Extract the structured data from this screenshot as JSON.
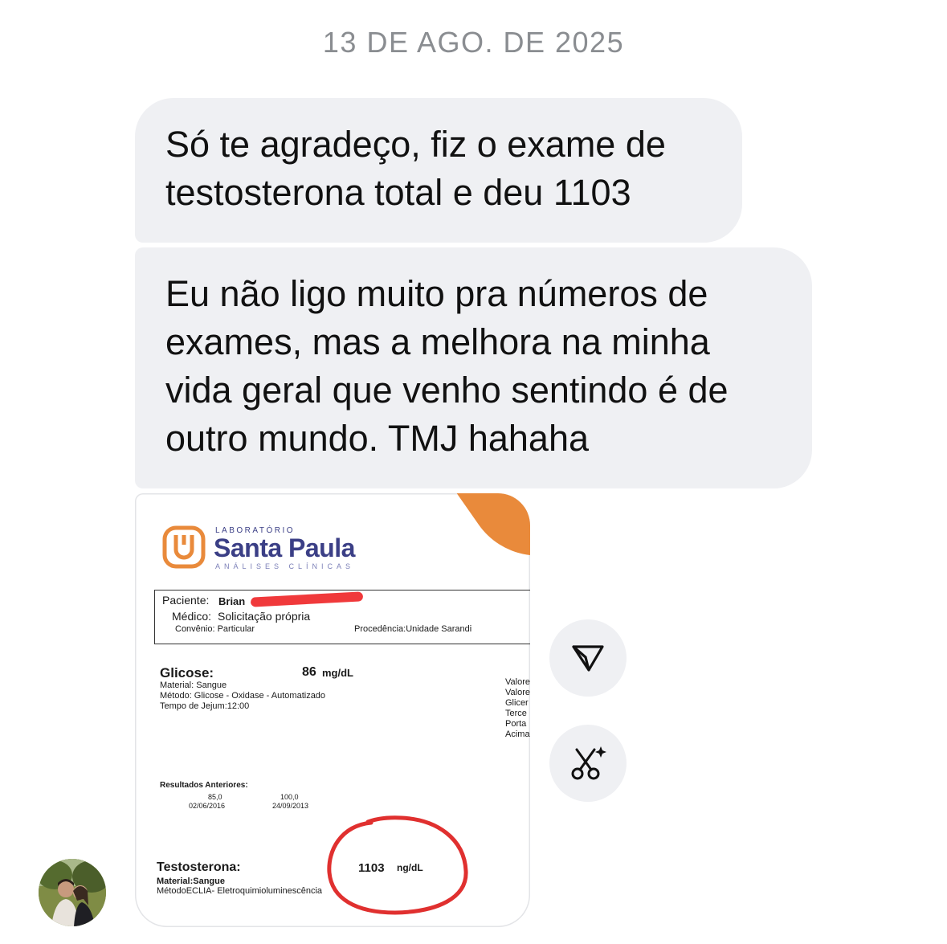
{
  "date_header": "13 DE AGO. DE 2025",
  "messages": [
    {
      "text": "Só te agradeço, fiz o exame de\ntestosterona total e deu 1103"
    },
    {
      "text": "Eu não ligo muito pra números de\nexames, mas a melhora na minha\nvida geral que venho sentindo é de\noutro mundo. TMJ hahaha"
    }
  ],
  "attachment": {
    "lab_top": "LABORATÓRIO",
    "lab_name": "Santa Paula",
    "lab_sub": "ANÁLISES CLÍNICAS",
    "paciente_label": "Paciente:",
    "paciente_name": "Brian",
    "medico_label": "Médico:",
    "medico_value": "Solicitação própria",
    "convenio": "Convênio: Particular",
    "procedencia": "Procedência:Unidade Sarandi",
    "glicose_label": "Glicose:",
    "glicose_value": "86",
    "glicose_unit": "mg/dL",
    "glicose_details": "Material: Sangue\nMétodo: Glicose - Oxidase - Automatizado\nTempo de Jejum:12:00",
    "ref_cut": "Valore\nValore\nGlicer\nTerce\nPorta\nAcima",
    "anteriores_label": "Resultados Anteriores:",
    "anteriores": [
      {
        "value": "85,0",
        "date": "02/06/2016"
      },
      {
        "value": "100,0",
        "date": "24/09/2013"
      }
    ],
    "testo_label": "Testosterona:",
    "testo_value": "1103",
    "testo_unit": "ng/dL",
    "testo_material": "Material:Sangue",
    "testo_metodo": "MétodoECLIA- Eletroquimioluminescência"
  },
  "actions": {
    "share_icon": "send-icon",
    "cut_icon": "scissors-sparkle-icon"
  },
  "colors": {
    "bubble": "#eff0f3",
    "brand": "#3b3f86",
    "orange": "#e98a3b",
    "circle": "#e0302f"
  }
}
